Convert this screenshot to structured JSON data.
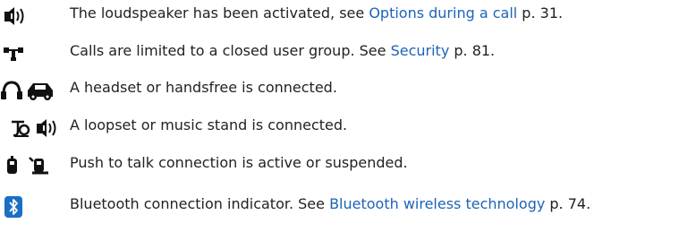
{
  "items": [
    {
      "icon": "loudspeaker-icon",
      "text_before": "The loudspeaker has been activated, see ",
      "link": "Options during a call",
      "text_after": " p. 31."
    },
    {
      "icon": "closed-user-group-icon",
      "text_before": "Calls are limited to a closed user group. See ",
      "link": "Security",
      "text_after": " p. 81."
    },
    {
      "icon": "headset-handsfree-icon",
      "text": "A headset or handsfree is connected."
    },
    {
      "icon": "loopset-music-stand-icon",
      "text": "A loopset or music stand is connected."
    },
    {
      "icon": "push-to-talk-icon",
      "text": "Push to talk connection is active or suspended."
    },
    {
      "icon": "bluetooth-icon",
      "text_before": "Bluetooth connection indicator. See ",
      "link": "Bluetooth wireless technology",
      "text_after": " p. 74."
    }
  ],
  "colors": {
    "text": "#222222",
    "link": "#1e63b8",
    "icon": "#111111",
    "bluetooth": "#1a6fc2"
  }
}
